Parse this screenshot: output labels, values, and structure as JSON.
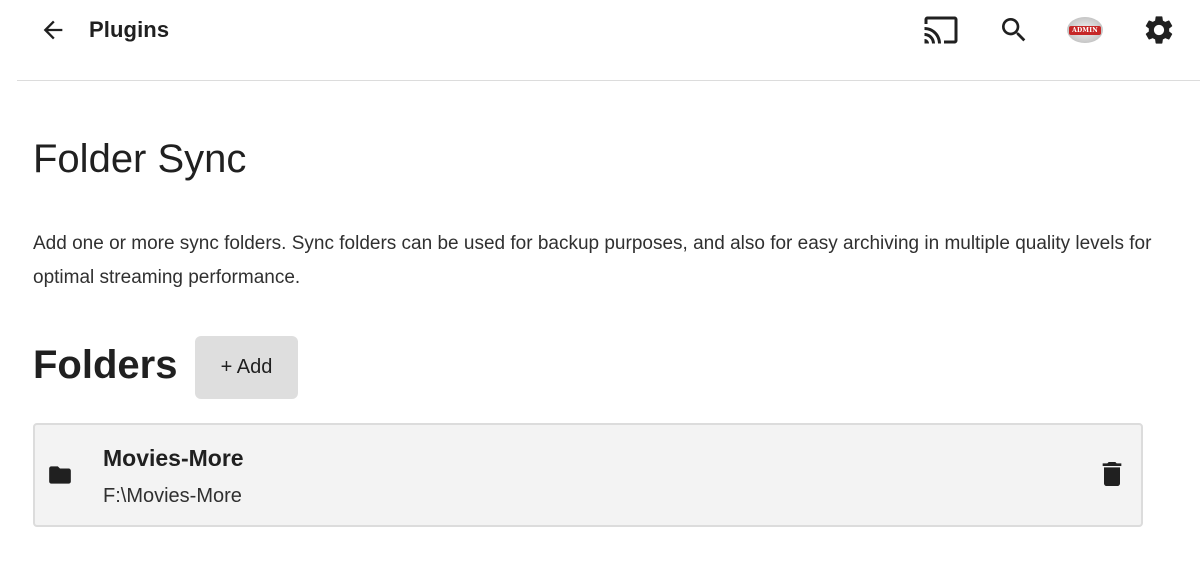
{
  "header": {
    "title": "Plugins",
    "back_icon": "arrow-left-icon",
    "actions": [
      {
        "name": "cast",
        "icon": "cast-icon"
      },
      {
        "name": "search",
        "icon": "search-icon"
      },
      {
        "name": "user-avatar",
        "badge": "ADMIN"
      },
      {
        "name": "settings",
        "icon": "gear-icon"
      }
    ]
  },
  "plugin": {
    "title": "Folder Sync",
    "description": "Add one or more sync folders. Sync folders can be used for backup purposes, and also for easy archiving in multiple quality levels for optimal streaming performance."
  },
  "folders_section": {
    "heading": "Folders",
    "add_label": "+ Add",
    "items": [
      {
        "name": "Movies-More",
        "path": "F:\\Movies-More",
        "icon": "folder-icon",
        "delete_icon": "trash-icon"
      }
    ]
  },
  "colors": {
    "text": "#202020",
    "divider": "#dcdcdc",
    "card_bg": "#f3f3f3",
    "button_bg": "#dedede",
    "badge": "#c62828"
  }
}
